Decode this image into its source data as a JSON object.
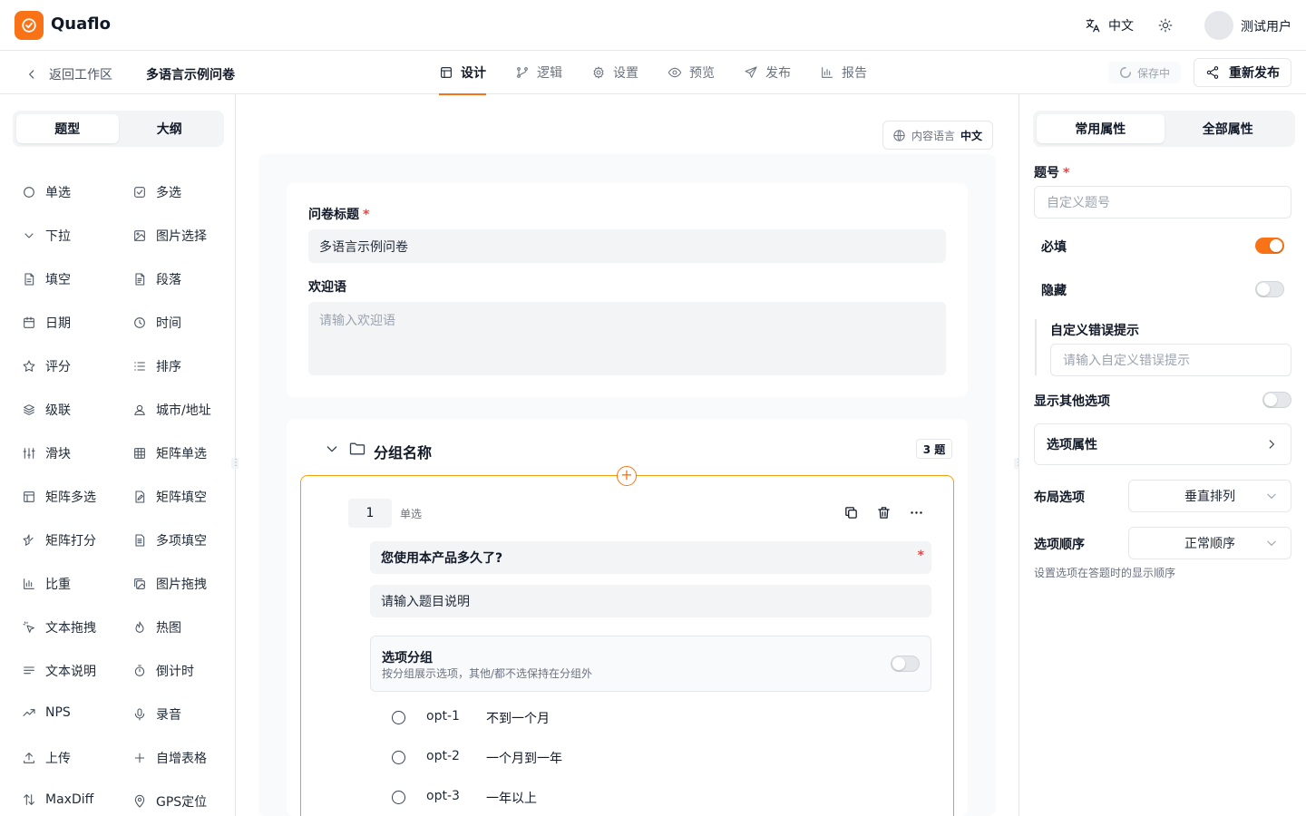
{
  "app": {
    "brand": "Quaflo",
    "language": "中文",
    "user_name": "测试用户"
  },
  "subbar": {
    "back_label": "返回工作区",
    "survey_name": "多语言示例问卷",
    "tabs": [
      {
        "label": "设计",
        "icon": "layout-icon"
      },
      {
        "label": "逻辑",
        "icon": "branch-icon"
      },
      {
        "label": "设置",
        "icon": "gear-icon"
      },
      {
        "label": "预览",
        "icon": "eye-icon"
      },
      {
        "label": "发布",
        "icon": "send-icon"
      },
      {
        "label": "报告",
        "icon": "bar-chart-icon"
      }
    ],
    "active_tab": "设计",
    "saving_label": "保存中",
    "republish_label": "重新发布"
  },
  "left_panel": {
    "tabs": [
      "题型",
      "大纲"
    ],
    "active_tab": "题型",
    "question_types": [
      {
        "label": "单选",
        "icon": "radio-icon"
      },
      {
        "label": "多选",
        "icon": "checkbox-icon"
      },
      {
        "label": "下拉",
        "icon": "chevron-down-icon"
      },
      {
        "label": "图片选择",
        "icon": "image-icon"
      },
      {
        "label": "填空",
        "icon": "document-icon"
      },
      {
        "label": "段落",
        "icon": "document-text-icon"
      },
      {
        "label": "日期",
        "icon": "calendar-icon"
      },
      {
        "label": "时间",
        "icon": "clock-icon"
      },
      {
        "label": "评分",
        "icon": "star-icon"
      },
      {
        "label": "排序",
        "icon": "list-icon"
      },
      {
        "label": "级联",
        "icon": "layers-icon"
      },
      {
        "label": "城市/地址",
        "icon": "user-location-icon"
      },
      {
        "label": "滑块",
        "icon": "sliders-icon"
      },
      {
        "label": "矩阵单选",
        "icon": "grid-icon"
      },
      {
        "label": "矩阵多选",
        "icon": "table-icon"
      },
      {
        "label": "矩阵填空",
        "icon": "document-edit-icon"
      },
      {
        "label": "矩阵打分",
        "icon": "half-star-icon"
      },
      {
        "label": "多项填空",
        "icon": "document-lines-icon"
      },
      {
        "label": "比重",
        "icon": "bar-chart-icon"
      },
      {
        "label": "图片拖拽",
        "icon": "images-icon"
      },
      {
        "label": "文本拖拽",
        "icon": "pointer-click-icon"
      },
      {
        "label": "热图",
        "icon": "flame-icon"
      },
      {
        "label": "文本说明",
        "icon": "align-left-icon"
      },
      {
        "label": "倒计时",
        "icon": "timer-icon"
      },
      {
        "label": "NPS",
        "icon": "trending-up-icon"
      },
      {
        "label": "录音",
        "icon": "mic-icon"
      },
      {
        "label": "上传",
        "icon": "upload-icon"
      },
      {
        "label": "自增表格",
        "icon": "plus-icon"
      },
      {
        "label": "MaxDiff",
        "icon": "sort-arrows-icon"
      },
      {
        "label": "GPS定位",
        "icon": "map-pin-icon"
      }
    ]
  },
  "canvas": {
    "content_language_label": "内容语言",
    "content_language_value": "中文",
    "survey_title_label": "问卷标题",
    "survey_title_value": "多语言示例问卷",
    "welcome_label": "欢迎语",
    "welcome_placeholder": "请输入欢迎语",
    "group": {
      "name": "分组名称",
      "count": "3 题"
    },
    "question": {
      "number": "1",
      "type": "单选",
      "title": "您使用本产品多久了?",
      "description_placeholder": "请输入题目说明",
      "option_group_title": "选项分组",
      "option_group_desc": "按分组展示选项，其他/都不选保持在分组外",
      "option_group_enabled": false,
      "options": [
        {
          "id": "opt-1",
          "text": "不到一个月"
        },
        {
          "id": "opt-2",
          "text": "一个月到一年"
        },
        {
          "id": "opt-3",
          "text": "一年以上"
        }
      ]
    }
  },
  "right_panel": {
    "tabs": [
      "常用属性",
      "全部属性"
    ],
    "active_tab": "常用属性",
    "question_no_label": "题号",
    "question_no_placeholder": "自定义题号",
    "required_label": "必填",
    "required_on": true,
    "hidden_label": "隐藏",
    "hidden_on": false,
    "custom_error_label": "自定义错误提示",
    "custom_error_placeholder": "请输入自定义错误提示",
    "show_other_label": "显示其他选项",
    "show_other_on": false,
    "option_props_label": "选项属性",
    "layout_label": "布局选项",
    "layout_value": "垂直排列",
    "order_label": "选项顺序",
    "order_value": "正常顺序",
    "order_hint": "设置选项在答题时的显示顺序"
  },
  "colors": {
    "accent": "#f97316",
    "required": "#ef4444",
    "border": "#e5e7eb"
  }
}
